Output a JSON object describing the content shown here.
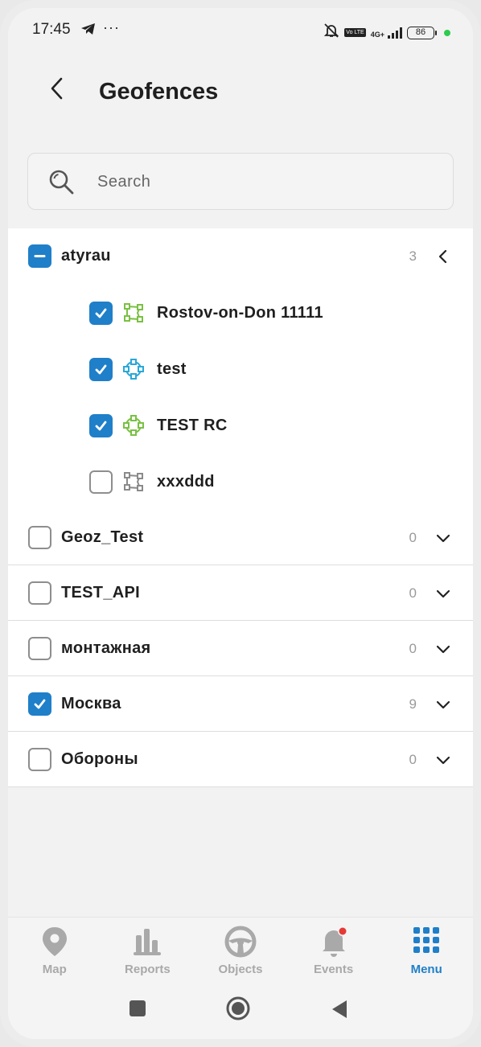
{
  "status_bar": {
    "time": "17:45",
    "more": "···",
    "network": "4G+",
    "volte": "Vo LTE",
    "battery": "86"
  },
  "header": {
    "title": "Geofences"
  },
  "search": {
    "placeholder": "Search"
  },
  "groups": [
    {
      "name": "atyrau",
      "count": "3",
      "state": "partial",
      "expanded": true,
      "items": [
        {
          "name": "Rostov-on-Don 11111",
          "checked": true,
          "icon": "polygon-geofence-icon",
          "color": "#7ac143"
        },
        {
          "name": "test",
          "checked": true,
          "icon": "circle-geofence-icon",
          "color": "#2aa8d8"
        },
        {
          "name": "TEST RC",
          "checked": true,
          "icon": "circle-geofence-icon",
          "color": "#7ac143"
        },
        {
          "name": "xxxddd",
          "checked": false,
          "icon": "polygon-geofence-icon",
          "color": "#8a8a8a"
        }
      ]
    },
    {
      "name": "Geoz_Test",
      "count": "0",
      "state": "unchecked",
      "expanded": false
    },
    {
      "name": "TEST_API",
      "count": "0",
      "state": "unchecked",
      "expanded": false
    },
    {
      "name": "монтажная",
      "count": "0",
      "state": "unchecked",
      "expanded": false
    },
    {
      "name": "Москва",
      "count": "9",
      "state": "checked",
      "expanded": false
    },
    {
      "name": "Обороны",
      "count": "0",
      "state": "unchecked",
      "expanded": false
    }
  ],
  "nav": {
    "tabs": [
      {
        "label": "Map",
        "icon": "map-pin-icon"
      },
      {
        "label": "Reports",
        "icon": "bar-chart-icon"
      },
      {
        "label": "Objects",
        "icon": "steering-wheel-icon"
      },
      {
        "label": "Events",
        "icon": "bell-icon"
      },
      {
        "label": "Menu",
        "icon": "grid-menu-icon"
      }
    ],
    "active": "Menu"
  },
  "colors": {
    "accent": "#1f7fc9",
    "event_badge": "#e53935"
  }
}
